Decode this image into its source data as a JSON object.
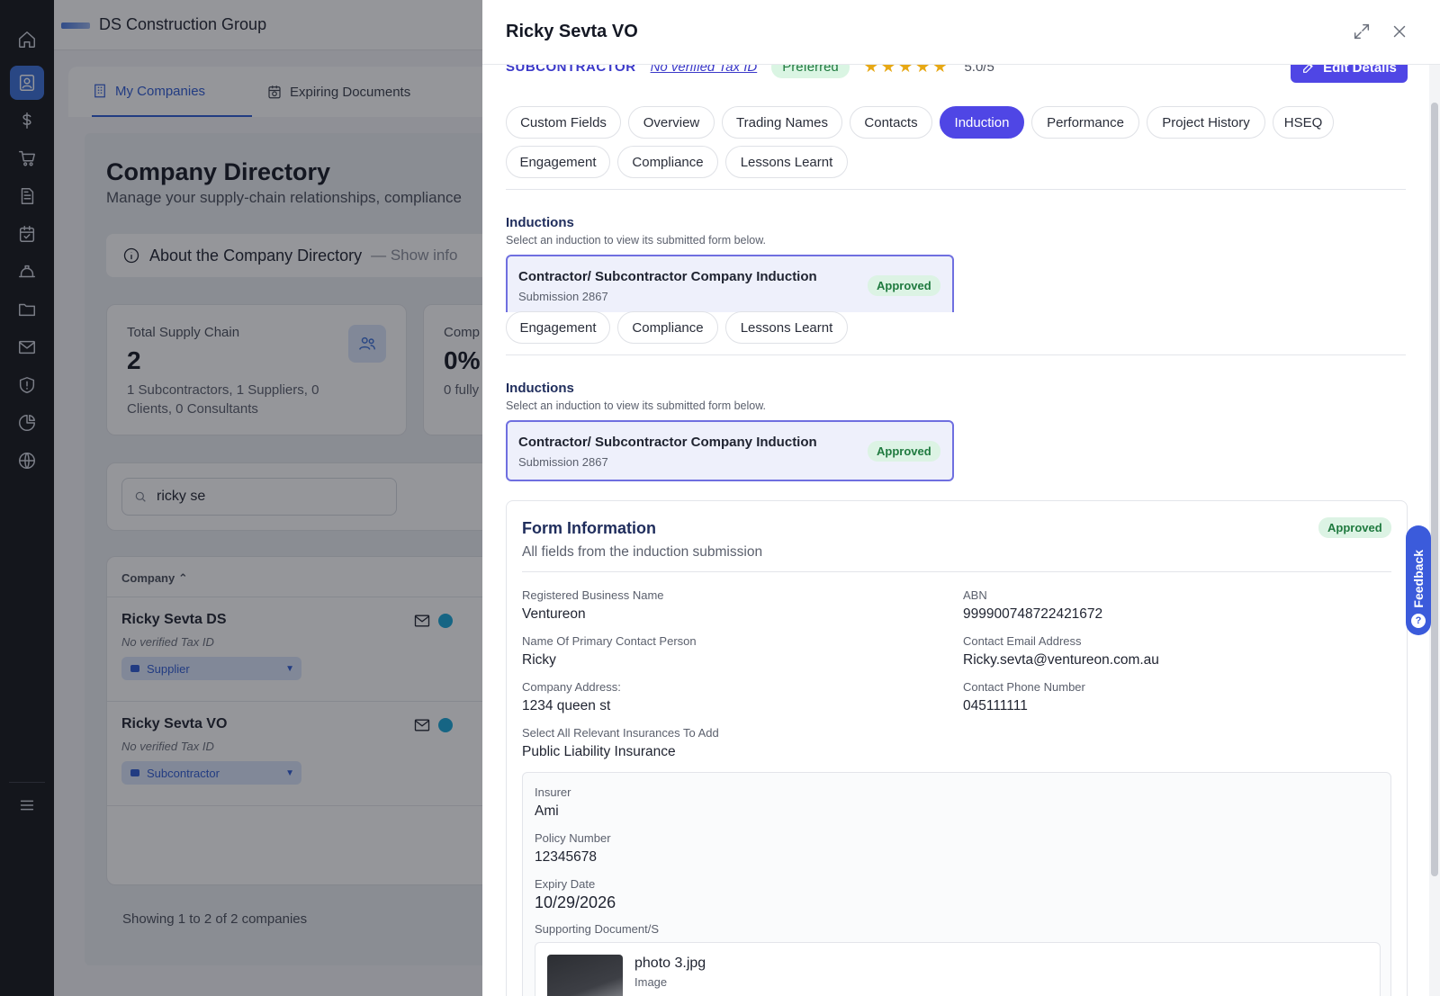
{
  "app": {
    "org_name": "DS Construction Group",
    "tabs": [
      {
        "label": "My Companies",
        "icon": "building-icon"
      },
      {
        "label": "Expiring Documents",
        "icon": "calendar-clock-icon"
      }
    ]
  },
  "rail": [
    "home-icon",
    "user-card-icon",
    "dollar-icon",
    "cart-icon",
    "document-icon",
    "calendar-check-icon",
    "hard-hat-icon",
    "folder-icon",
    "mail-icon",
    "shield-icon",
    "pie-chart-icon",
    "globe-icon",
    "menu-icon"
  ],
  "directory": {
    "title": "Company Directory",
    "subtitle": "Manage your supply-chain relationships, compliance",
    "about_label": "About the Company Directory",
    "about_toggle": "— Show info",
    "stats": [
      {
        "label": "Total Supply Chain",
        "value": "2",
        "desc": "1 Subcontractors, 1 Suppliers, 0 Clients, 0 Consultants"
      },
      {
        "label": "Comp",
        "value": "0%",
        "desc": "0 fully"
      }
    ],
    "search_value": "ricky se",
    "column_company": "Company ⌃",
    "rows": [
      {
        "name": "Ricky Sevta DS",
        "tax": "No verified Tax ID",
        "type": "Supplier"
      },
      {
        "name": "Ricky Sevta VO",
        "tax": "No verified Tax ID",
        "type": "Subcontractor"
      }
    ],
    "showing": "Showing 1 to 2 of 2 companies"
  },
  "drawer": {
    "title": "Ricky Sevta VO",
    "type": "SUBCONTRACTOR",
    "tax": "No verified Tax ID",
    "preferred": "Preferred",
    "stars": "★★★★★",
    "rating": "5.0/5",
    "edit_label": "Edit Details",
    "tabs_row1": [
      "Custom Fields",
      "Overview",
      "Trading Names",
      "Contacts",
      "Induction",
      "Performance",
      "Project History",
      "HSEQ"
    ],
    "tabs_row2": [
      "Engagement",
      "Compliance",
      "Lessons Learnt"
    ],
    "active_tab": "Induction",
    "inductions_title": "Inductions",
    "inductions_sub": "Select an induction to view its submitted form below.",
    "induction": {
      "name": "Contractor/ Subcontractor Company Induction",
      "submission": "Submission 2867",
      "status": "Approved"
    },
    "form": {
      "title": "Form Information",
      "subtitle": "All fields from the induction submission",
      "status": "Approved",
      "fields": [
        {
          "label": "Registered Business Name",
          "value": "Ventureon"
        },
        {
          "label": "ABN",
          "value": "999900748722421672"
        },
        {
          "label": "Name Of Primary Contact Person",
          "value": "Ricky"
        },
        {
          "label": "Contact Email Address",
          "value": "Ricky.sevta@ventureon.com.au"
        },
        {
          "label": "Company Address:",
          "value": "1234 queen st"
        },
        {
          "label": "Contact Phone Number",
          "value": "045111111"
        },
        {
          "label": "Select All Relevant Insurances To Add",
          "value": "Public Liability Insurance"
        }
      ],
      "insurance": {
        "insurer_label": "Insurer",
        "insurer": "Ami",
        "policy_label": "Policy Number",
        "policy": "12345678",
        "expiry_label": "Expiry Date",
        "expiry": "10/29/2026",
        "docs_label": "Supporting Document/S",
        "doc_name": "photo 3.jpg",
        "doc_type": "Image"
      }
    },
    "feedback_label": "Feedback",
    "feedback_q": "?"
  }
}
